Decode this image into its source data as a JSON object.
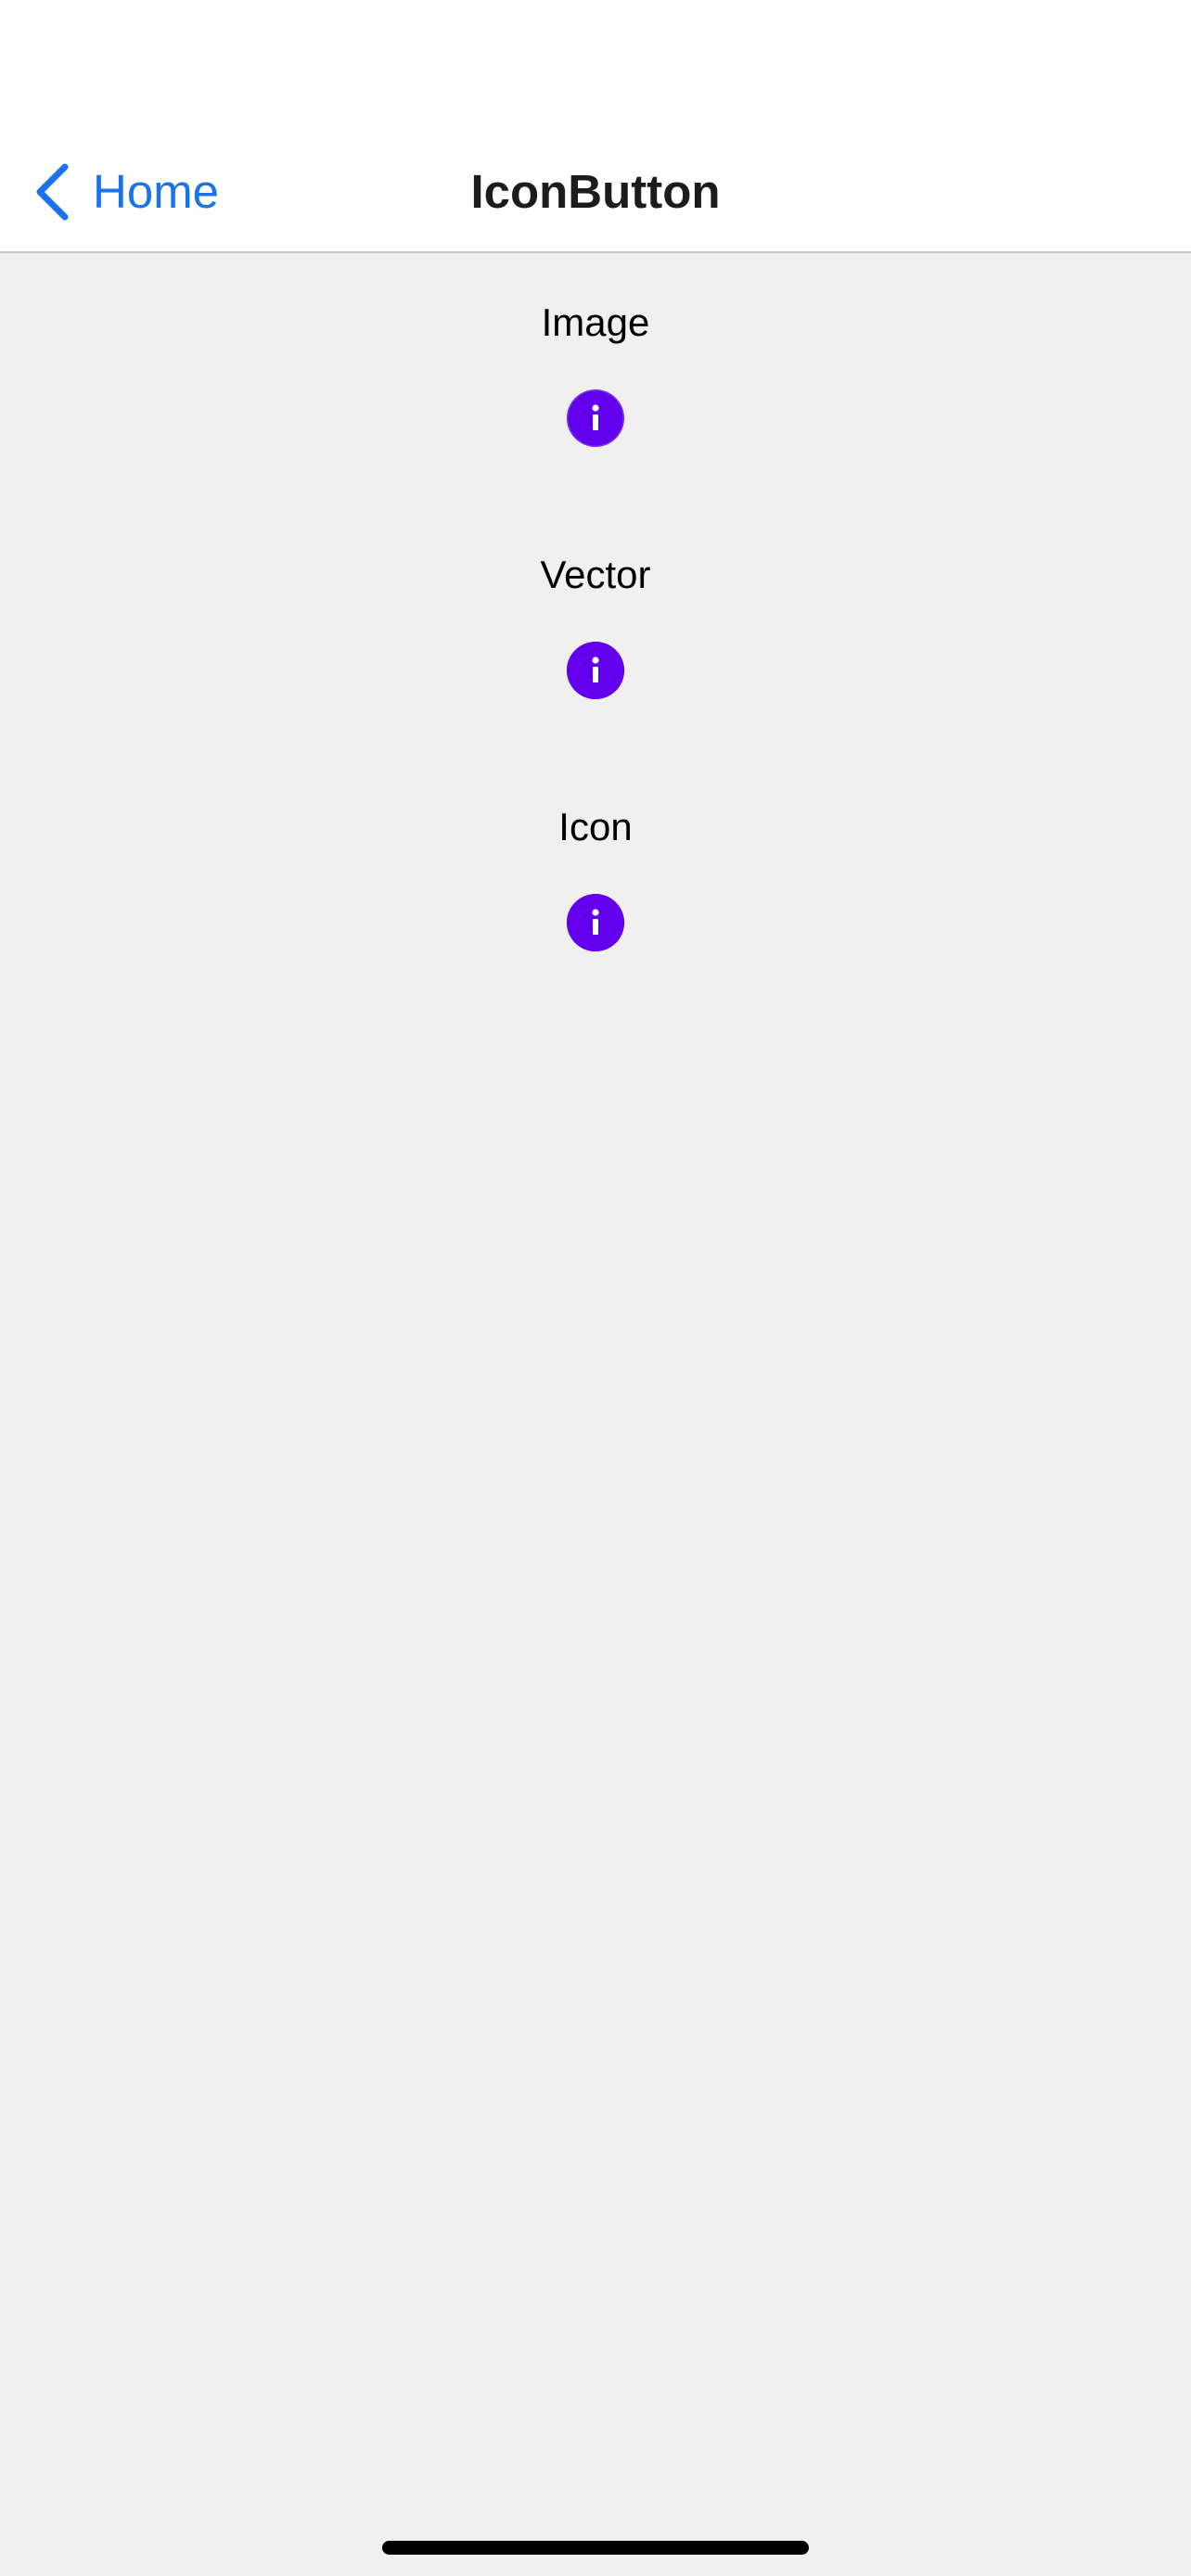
{
  "navbar": {
    "back_label": "Home",
    "title": "IconButton"
  },
  "sections": [
    {
      "label": "Image",
      "icon": "info-icon"
    },
    {
      "label": "Vector",
      "icon": "info-icon"
    },
    {
      "label": "Icon",
      "icon": "info-icon"
    }
  ],
  "colors": {
    "accent": "#1a73e8",
    "icon_button": "#6200ee",
    "background": "#f0f0f0",
    "navbar": "#ffffff"
  }
}
